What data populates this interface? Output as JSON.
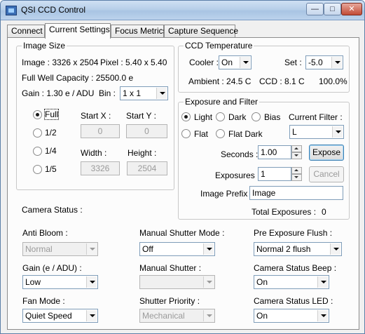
{
  "window": {
    "title": "QSI CCD Control"
  },
  "tabs": [
    "Connect",
    "Current Settings",
    "Focus Metrics",
    "Capture Sequence"
  ],
  "image_size": {
    "group_title": "Image Size",
    "image_label": "Image : 3326 x 2504",
    "pixel_label": "Pixel :  5.40 x  5.40",
    "full_well": "Full Well Capacity : 25500.0 e",
    "gain_label": "Gain :  1.30 e / ADU",
    "bin_label": "Bin :",
    "bin_value": "1 x 1",
    "options": [
      "Full",
      "1/2",
      "1/4",
      "1/5"
    ],
    "start_x_label": "Start X :",
    "start_y_label": "Start Y :",
    "start_x": "0",
    "start_y": "0",
    "width_label": "Width :",
    "height_label": "Height :",
    "width": "3326",
    "height": "2504"
  },
  "temperature": {
    "group_title": "CCD Temperature",
    "cooler_label": "Cooler :",
    "cooler_value": "On",
    "set_label": "Set :",
    "set_value": "-5.0",
    "ambient": "Ambient : 24.5 C",
    "ccd": "CCD : 8.1 C",
    "power": "100.0%"
  },
  "exposure": {
    "group_title": "Exposure and Filter",
    "frame_types": [
      "Light",
      "Dark",
      "Bias",
      "Flat",
      "Flat Dark"
    ],
    "current_filter_label": "Current Filter :",
    "current_filter_value": "L",
    "seconds_label": "Seconds :",
    "seconds_value": "1.00",
    "expose_button": "Expose",
    "exposures_label": "Exposures :",
    "exposures_value": "1",
    "cancel_button": "Cancel",
    "prefix_label": "Image Prefix :",
    "prefix_value": "Image",
    "total_label": "Total Exposures :",
    "total_value": "0"
  },
  "camera_status": {
    "title": "Camera Status :",
    "anti_bloom_label": "Anti Bloom :",
    "anti_bloom_value": "Normal",
    "manual_shutter_mode_label": "Manual Shutter Mode :",
    "manual_shutter_mode_value": "Off",
    "pre_exposure_flush_label": "Pre Exposure Flush :",
    "pre_exposure_flush_value": "Normal 2 flush",
    "gain_label": "Gain (e / ADU) :",
    "gain_value": "Low",
    "manual_shutter_label": "Manual Shutter :",
    "manual_shutter_value": "",
    "status_beep_label": "Camera Status Beep :",
    "status_beep_value": "On",
    "fan_mode_label": "Fan Mode :",
    "fan_mode_value": "Quiet Speed",
    "shutter_priority_label": "Shutter Priority :",
    "shutter_priority_value": "Mechanical",
    "status_led_label": "Camera Status LED :",
    "status_led_value": "On"
  }
}
